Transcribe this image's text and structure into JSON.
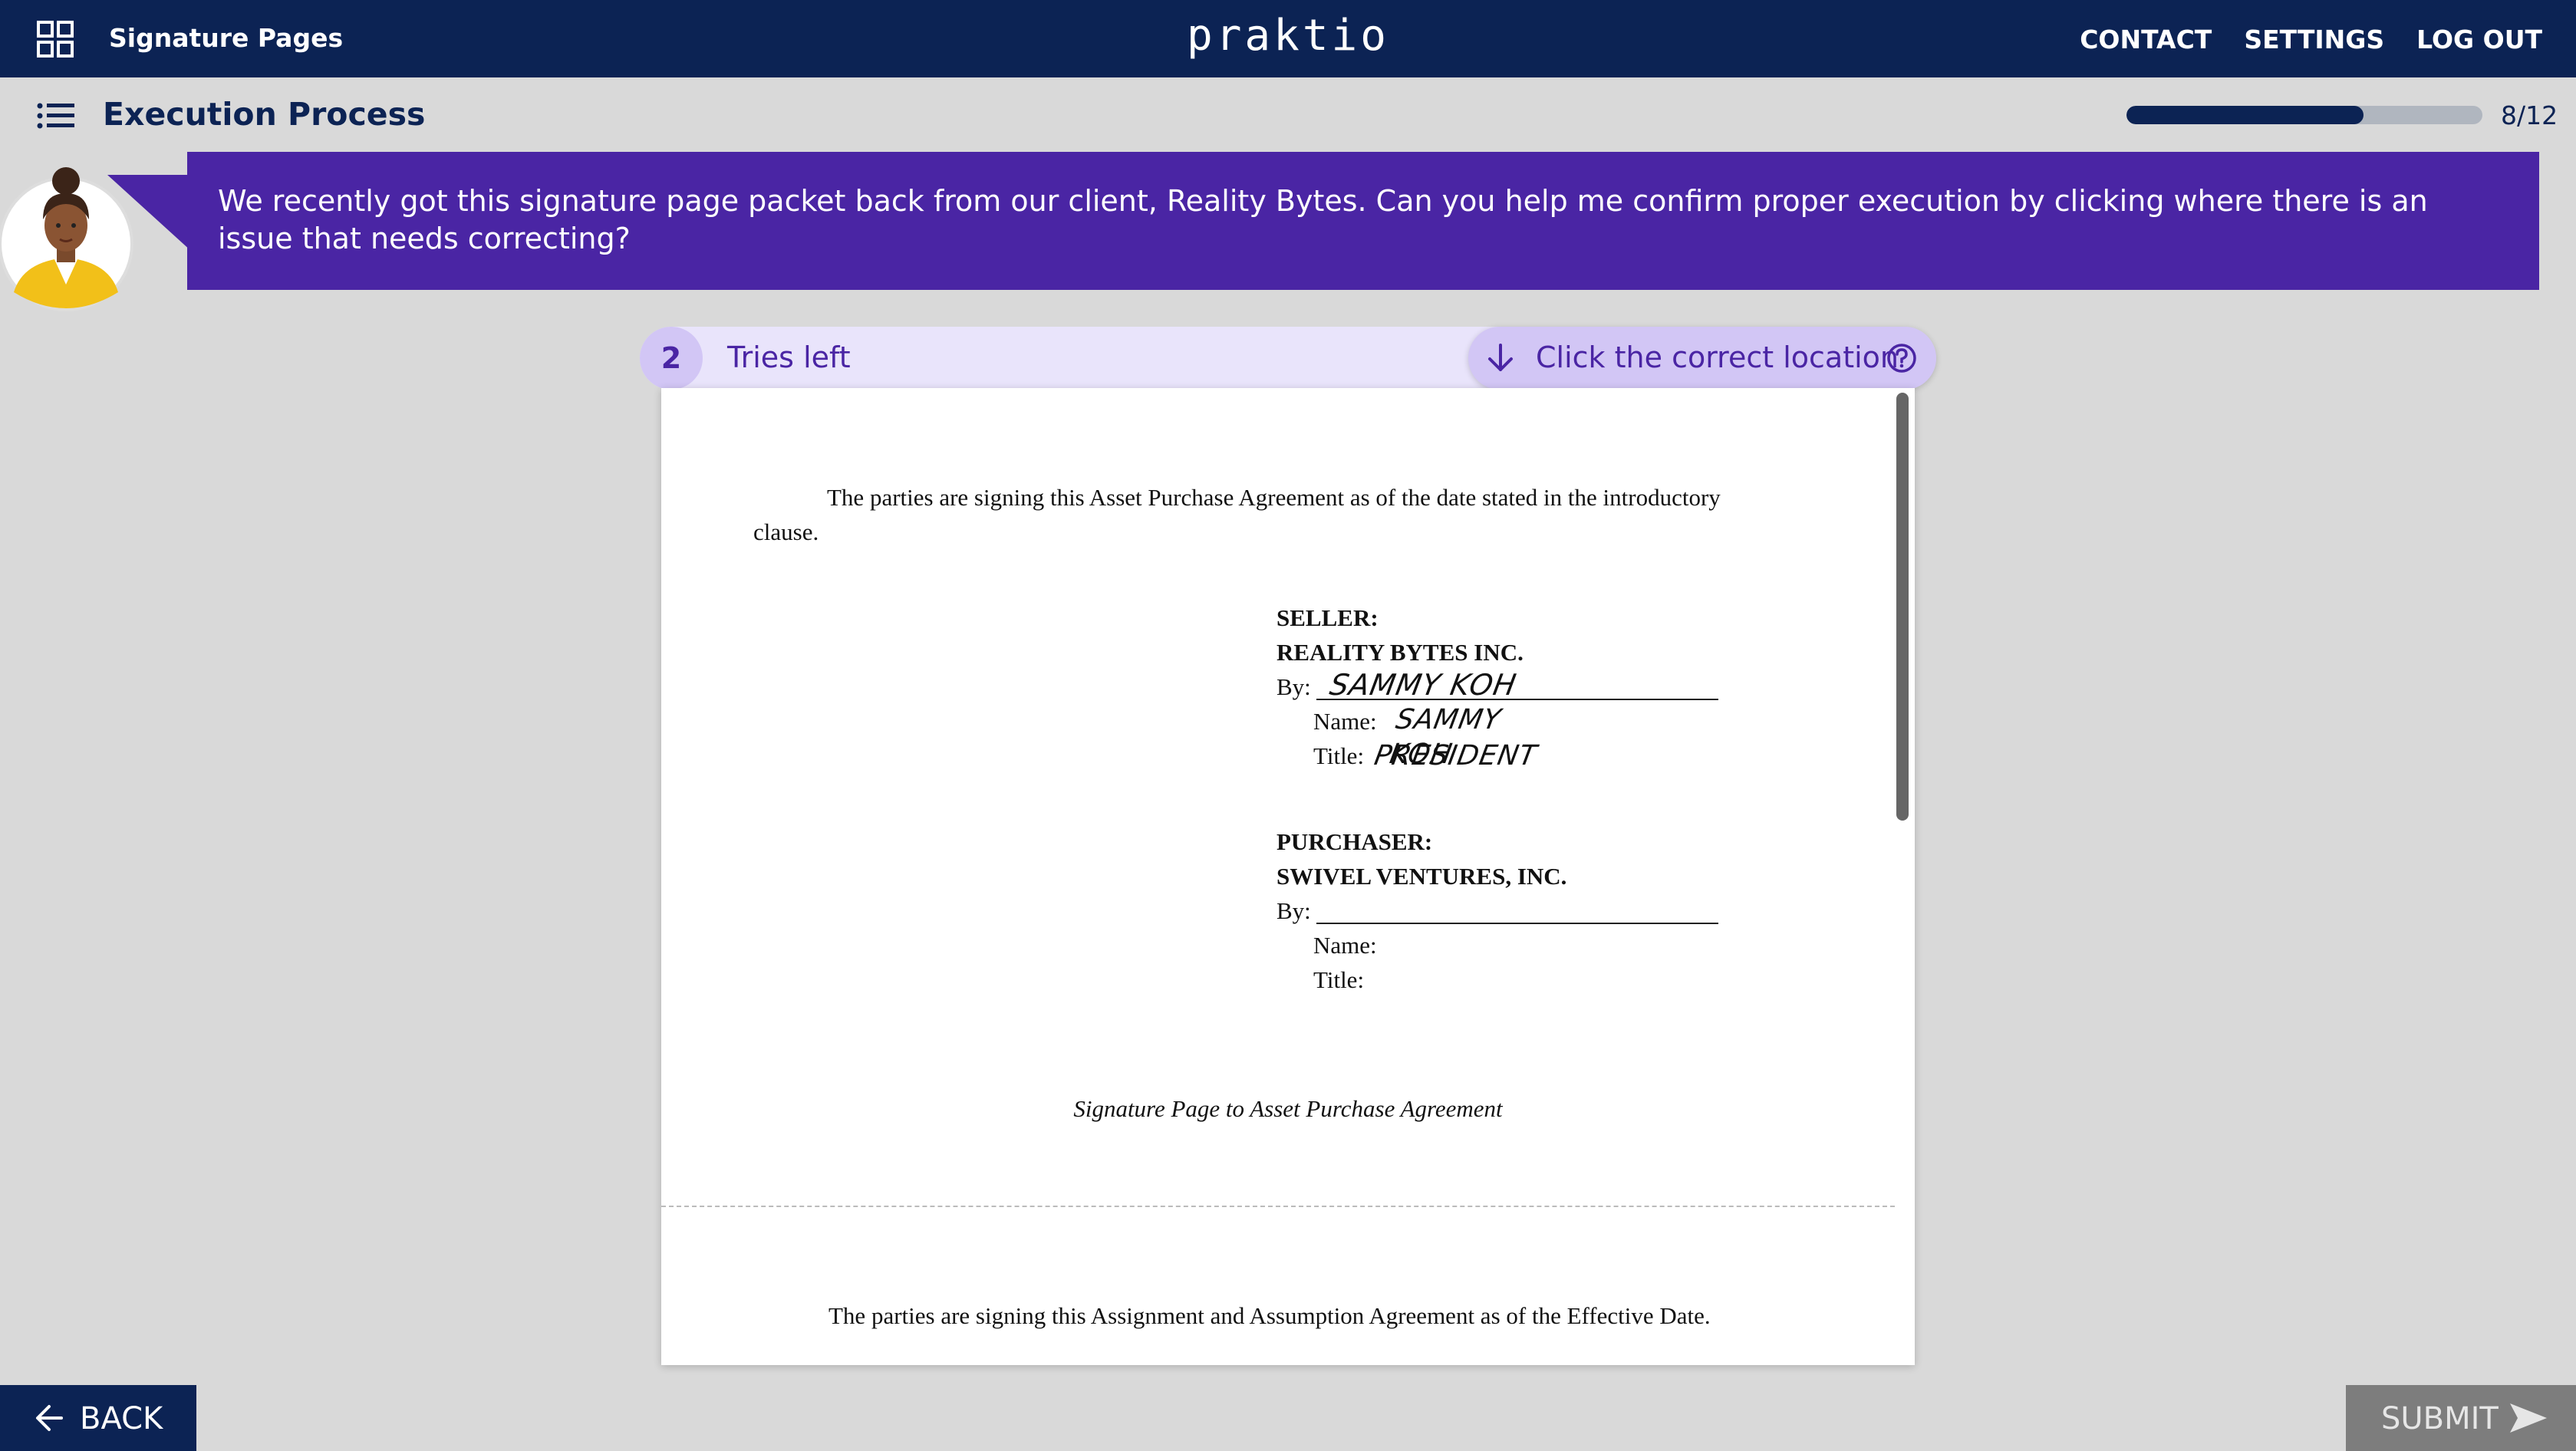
{
  "header": {
    "app_title": "Signature Pages",
    "logo": "praktio",
    "nav": [
      "CONTACT",
      "SETTINGS",
      "LOG OUT"
    ]
  },
  "subheader": {
    "section_title": "Execution Process",
    "progress_label": "8/12",
    "progress_fraction": 0.667
  },
  "prompt": {
    "message": "We recently got this signature page packet back from our client, Reality Bytes. Can you help me confirm proper execution by clicking where there is an issue that needs correcting?"
  },
  "task": {
    "tries_count": "2",
    "tries_label": "Tries left",
    "instruction": "Click the correct location"
  },
  "document": {
    "intro_para": "The parties are signing this Asset Purchase Agreement as of the date stated in the introductory clause.",
    "seller_heading": "SELLER:",
    "seller_entity": "REALITY BYTES INC.",
    "by_label": "By:",
    "seller_signature": "SAMMY KOH",
    "name_label": "Name:",
    "seller_name": "SAMMY KOH",
    "title_label": "Title:",
    "seller_title": "PRESIDENT",
    "purchaser_heading": "PURCHASER:",
    "purchaser_entity": "SWIVEL VENTURES, INC.",
    "caption": "Signature Page to Asset Purchase Agreement",
    "next_page_para": "The parties are signing this Assignment and Assumption Agreement as of the Effective Date."
  },
  "footer": {
    "back_label": "BACK",
    "submit_label": "SUBMIT"
  },
  "colors": {
    "navy": "#0c2354",
    "purple": "#4a25a4",
    "lavender": "#e9e4fb",
    "lavender_dark": "#d2c6f5"
  }
}
